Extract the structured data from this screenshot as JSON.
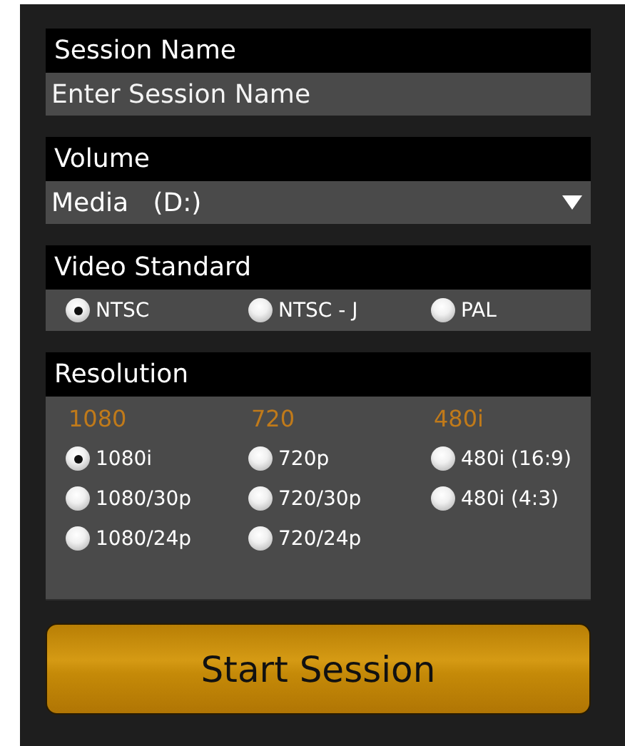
{
  "session_name": {
    "label": "Session Name",
    "placeholder": "Enter Session Name"
  },
  "volume": {
    "label": "Volume",
    "value": "Media   (D:)"
  },
  "video_standard": {
    "label": "Video Standard",
    "options": [
      {
        "label": "NTSC",
        "selected": true
      },
      {
        "label": "NTSC - J",
        "selected": false
      },
      {
        "label": "PAL",
        "selected": false
      }
    ]
  },
  "resolution": {
    "label": "Resolution",
    "groups": [
      {
        "title": "1080",
        "options": [
          {
            "label": "1080i",
            "selected": true
          },
          {
            "label": "1080/30p",
            "selected": false
          },
          {
            "label": "1080/24p",
            "selected": false
          }
        ]
      },
      {
        "title": "720",
        "options": [
          {
            "label": "720p",
            "selected": false
          },
          {
            "label": "720/30p",
            "selected": false
          },
          {
            "label": "720/24p",
            "selected": false
          }
        ]
      },
      {
        "title": "480i",
        "options": [
          {
            "label": "480i (16:9)",
            "selected": false
          },
          {
            "label": "480i (4:3)",
            "selected": false
          }
        ]
      }
    ]
  },
  "start_button": {
    "label": "Start Session"
  }
}
